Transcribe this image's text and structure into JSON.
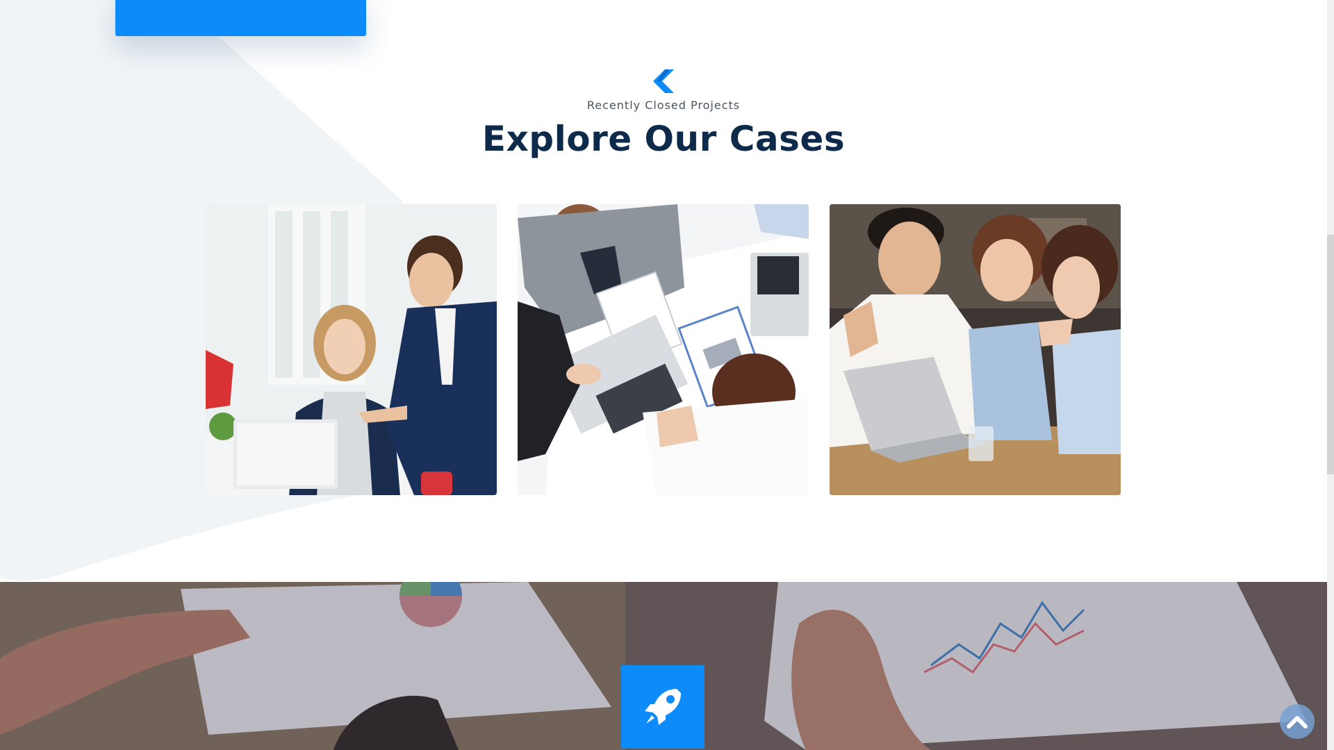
{
  "section": {
    "subtitle": "Recently Closed Projects",
    "title": "Explore Our Cases"
  },
  "cases": [
    {
      "name": "case-office-meeting"
    },
    {
      "name": "case-team-table-topview"
    },
    {
      "name": "case-team-laptop"
    }
  ],
  "icons": {
    "logo": "brand-logo-icon",
    "rocket": "rocket-icon",
    "scroll_top": "chevron-up-icon"
  },
  "colors": {
    "accent": "#0d8cf9",
    "heading": "#0e2a4b",
    "subtitle": "#4a5361",
    "background_shape": "#f1f4f7"
  }
}
